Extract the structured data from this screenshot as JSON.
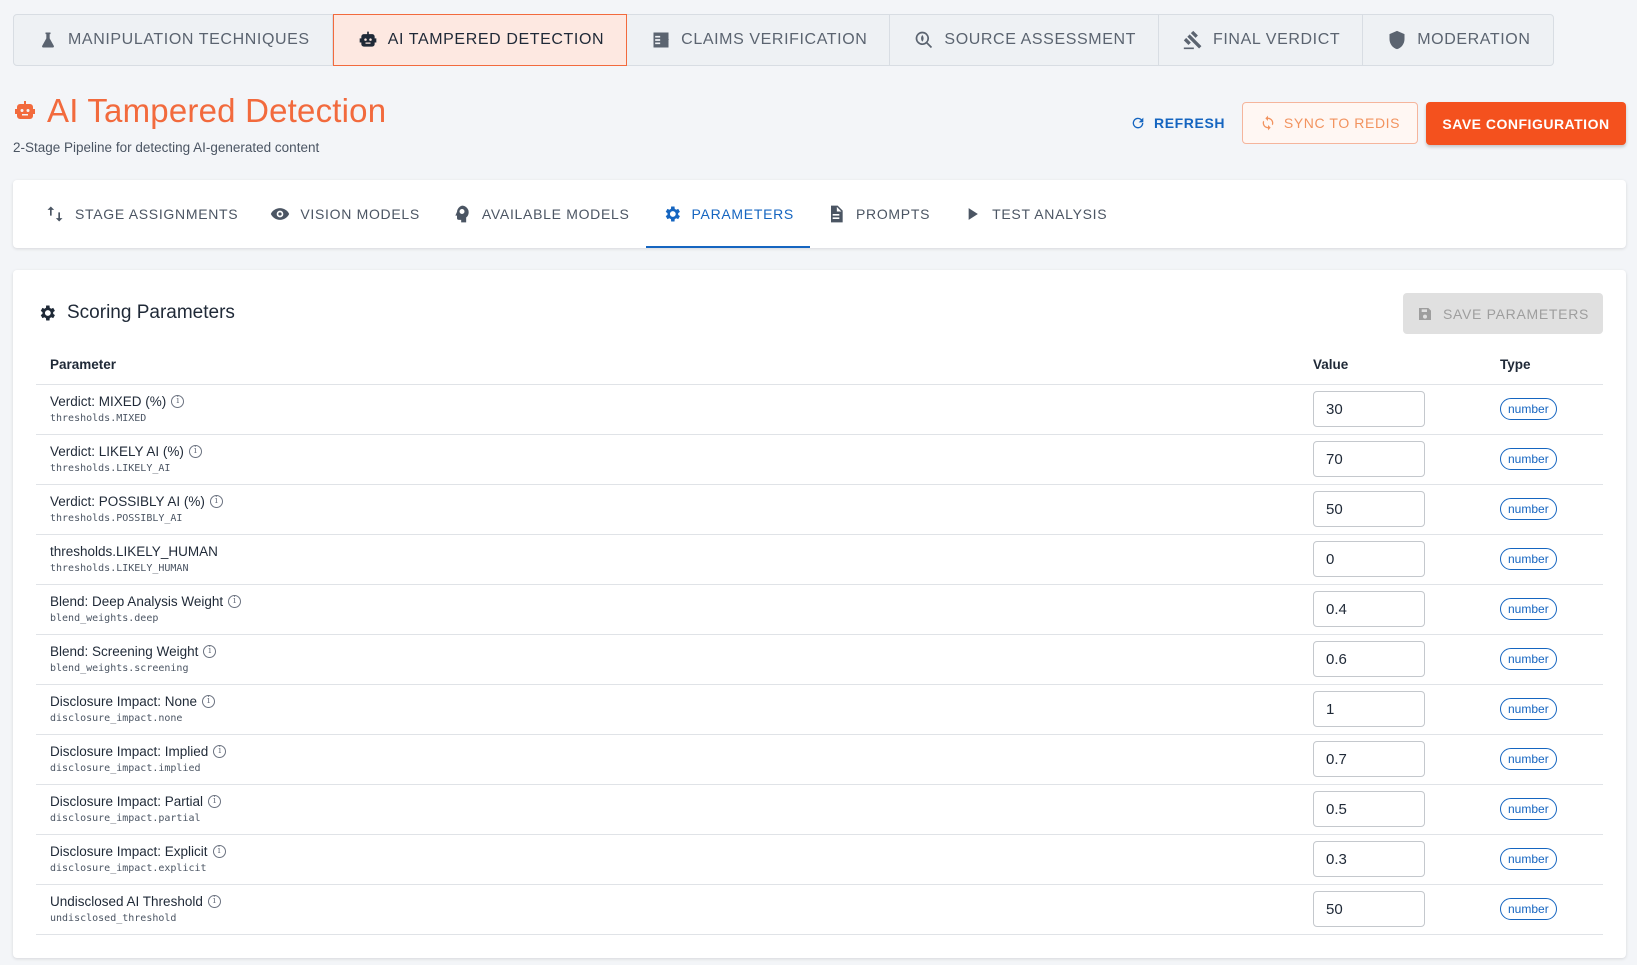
{
  "top_tabs": [
    {
      "label": "MANIPULATION TECHNIQUES",
      "icon": "flask-icon"
    },
    {
      "label": "AI TAMPERED DETECTION",
      "icon": "robot-icon"
    },
    {
      "label": "CLAIMS VERIFICATION",
      "icon": "checklist-icon"
    },
    {
      "label": "SOURCE ASSESSMENT",
      "icon": "search-globe-icon"
    },
    {
      "label": "FINAL VERDICT",
      "icon": "gavel-icon"
    },
    {
      "label": "MODERATION",
      "icon": "shield-icon"
    }
  ],
  "header": {
    "title": "AI Tampered Detection",
    "subtitle": "2-Stage Pipeline for detecting AI-generated content",
    "refresh_label": "REFRESH",
    "sync_label": "SYNC TO REDIS",
    "save_label": "SAVE CONFIGURATION"
  },
  "sub_tabs": [
    {
      "label": "STAGE ASSIGNMENTS",
      "icon": "swap-vertical-icon"
    },
    {
      "label": "VISION MODELS",
      "icon": "eye-icon"
    },
    {
      "label": "AVAILABLE MODELS",
      "icon": "brain-icon"
    },
    {
      "label": "PARAMETERS",
      "icon": "gear-icon"
    },
    {
      "label": "PROMPTS",
      "icon": "document-icon"
    },
    {
      "label": "TEST ANALYSIS",
      "icon": "play-icon"
    }
  ],
  "params": {
    "title": "Scoring Parameters",
    "save_label": "SAVE PARAMETERS",
    "columns": {
      "parameter": "Parameter",
      "value": "Value",
      "type": "Type"
    },
    "rows": [
      {
        "label": "Verdict: MIXED (%)",
        "key": "thresholds.MIXED",
        "value": "30",
        "type": "number",
        "info": true
      },
      {
        "label": "Verdict: LIKELY AI (%)",
        "key": "thresholds.LIKELY_AI",
        "value": "70",
        "type": "number",
        "info": true
      },
      {
        "label": "Verdict: POSSIBLY AI (%)",
        "key": "thresholds.POSSIBLY_AI",
        "value": "50",
        "type": "number",
        "info": true
      },
      {
        "label": "thresholds.LIKELY_HUMAN",
        "key": "thresholds.LIKELY_HUMAN",
        "value": "0",
        "type": "number",
        "info": false
      },
      {
        "label": "Blend: Deep Analysis Weight",
        "key": "blend_weights.deep",
        "value": "0.4",
        "type": "number",
        "info": true
      },
      {
        "label": "Blend: Screening Weight",
        "key": "blend_weights.screening",
        "value": "0.6",
        "type": "number",
        "info": true
      },
      {
        "label": "Disclosure Impact: None",
        "key": "disclosure_impact.none",
        "value": "1",
        "type": "number",
        "info": true
      },
      {
        "label": "Disclosure Impact: Implied",
        "key": "disclosure_impact.implied",
        "value": "0.7",
        "type": "number",
        "info": true
      },
      {
        "label": "Disclosure Impact: Partial",
        "key": "disclosure_impact.partial",
        "value": "0.5",
        "type": "number",
        "info": true
      },
      {
        "label": "Disclosure Impact: Explicit",
        "key": "disclosure_impact.explicit",
        "value": "0.3",
        "type": "number",
        "info": true
      },
      {
        "label": "Undisclosed AI Threshold",
        "key": "undisclosed_threshold",
        "value": "50",
        "type": "number",
        "info": true
      }
    ]
  },
  "colors": {
    "accent": "#f4511e",
    "primary": "#1565c0"
  }
}
